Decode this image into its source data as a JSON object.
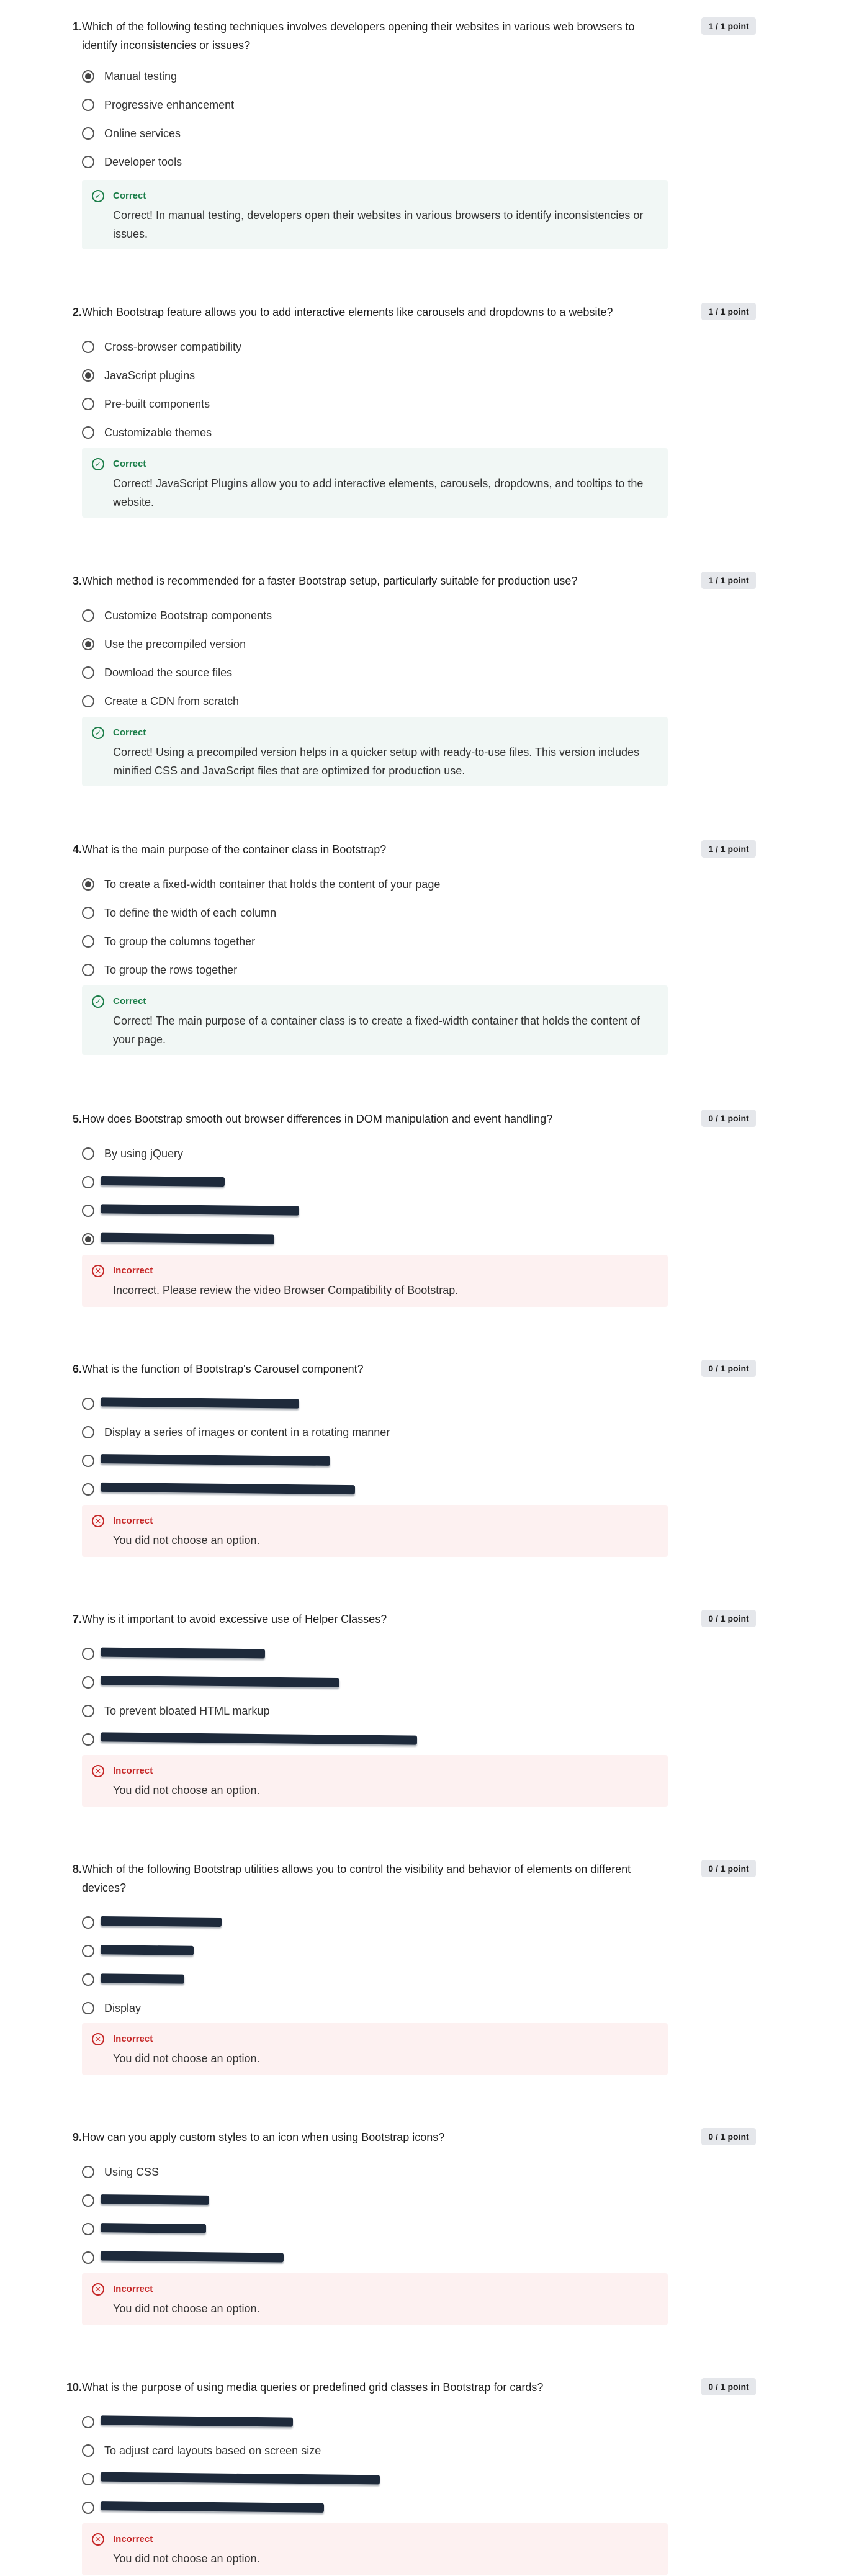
{
  "questions": [
    {
      "number": "1.",
      "text": "Which of the following testing techniques involves developers opening their websites in various web browsers to identify inconsistencies or issues?",
      "score": "1 / 1 point",
      "options": [
        {
          "label": "Manual testing",
          "selected": true
        },
        {
          "label": "Progressive enhancement",
          "selected": false
        },
        {
          "label": "Online services",
          "selected": false
        },
        {
          "label": "Developer tools",
          "selected": false
        }
      ],
      "feedback": {
        "status": "Correct",
        "text": "Correct! In manual testing, developers open their websites in various browsers to identify inconsistencies or issues."
      }
    },
    {
      "number": "2.",
      "text": "Which Bootstrap feature allows you to add interactive elements like carousels and dropdowns to a website?",
      "score": "1 / 1 point",
      "options": [
        {
          "label": "Cross-browser compatibility",
          "selected": false
        },
        {
          "label": "JavaScript plugins",
          "selected": true
        },
        {
          "label": "Pre-built components",
          "selected": false
        },
        {
          "label": "Customizable themes",
          "selected": false
        }
      ],
      "feedback": {
        "status": "Correct",
        "text": "Correct! JavaScript Plugins allow you to add interactive elements, carousels, dropdowns, and tooltips to the website."
      }
    },
    {
      "number": "3.",
      "text": "Which method is recommended for a faster Bootstrap setup, particularly suitable for production use?",
      "score": "1 / 1 point",
      "options": [
        {
          "label": "Customize Bootstrap components",
          "selected": false
        },
        {
          "label": "Use the precompiled version",
          "selected": true
        },
        {
          "label": "Download the source files",
          "selected": false
        },
        {
          "label": "Create a CDN from scratch",
          "selected": false
        }
      ],
      "feedback": {
        "status": "Correct",
        "text": "Correct! Using a precompiled version helps in a quicker setup with ready-to-use files. This version includes minified CSS and JavaScript files that are optimized for production use."
      }
    },
    {
      "number": "4.",
      "text": "What is the main purpose of the container class in Bootstrap?",
      "score": "1 / 1 point",
      "options": [
        {
          "label": "To create a fixed-width container that holds the content of your page",
          "selected": true
        },
        {
          "label": "To define the width of each column",
          "selected": false
        },
        {
          "label": "To group the columns together",
          "selected": false
        },
        {
          "label": "To group the rows together",
          "selected": false
        }
      ],
      "feedback": {
        "status": "Correct",
        "text": "Correct! The main purpose of a container class is to create a fixed-width container that holds the content of your page."
      }
    },
    {
      "number": "5.",
      "text": "How does Bootstrap smooth out browser differences in DOM manipulation and event handling?",
      "score": "0 / 1 point",
      "options": [
        {
          "label": "By using jQuery",
          "selected": false
        },
        {
          "label": "",
          "selected": false
        },
        {
          "label": "",
          "selected": false
        },
        {
          "label": "",
          "selected": true
        }
      ],
      "feedback": {
        "status": "Incorrect",
        "text": "Incorrect. Please review the video Browser Compatibility of Bootstrap."
      }
    },
    {
      "number": "6.",
      "text": "What is the function of Bootstrap's Carousel component?",
      "score": "0 / 1 point",
      "options": [
        {
          "label": "",
          "selected": false
        },
        {
          "label": "Display a series of images or content in a rotating manner",
          "selected": false
        },
        {
          "label": "",
          "selected": false
        },
        {
          "label": "",
          "selected": false
        }
      ],
      "feedback": {
        "status": "Incorrect",
        "text": "You did not choose an option."
      }
    },
    {
      "number": "7.",
      "text": "Why is it important to avoid excessive use of Helper Classes?",
      "score": "0 / 1 point",
      "options": [
        {
          "label": "",
          "selected": false
        },
        {
          "label": "",
          "selected": false
        },
        {
          "label": "To prevent bloated HTML markup",
          "selected": false
        },
        {
          "label": "",
          "selected": false
        }
      ],
      "feedback": {
        "status": "Incorrect",
        "text": "You did not choose an option."
      }
    },
    {
      "number": "8.",
      "text": "Which of the following Bootstrap utilities allows you to control the visibility and behavior of elements on different devices?",
      "score": "0 / 1 point",
      "options": [
        {
          "label": "",
          "selected": false
        },
        {
          "label": "",
          "selected": false
        },
        {
          "label": "",
          "selected": false
        },
        {
          "label": "Display",
          "selected": false
        }
      ],
      "feedback": {
        "status": "Incorrect",
        "text": "You did not choose an option."
      }
    },
    {
      "number": "9.",
      "text": "How can you apply custom styles to an icon when using Bootstrap icons?",
      "score": "0 / 1 point",
      "options": [
        {
          "label": "Using CSS",
          "selected": false
        },
        {
          "label": "",
          "selected": false
        },
        {
          "label": "",
          "selected": false
        },
        {
          "label": "",
          "selected": false
        }
      ],
      "feedback": {
        "status": "Incorrect",
        "text": "You did not choose an option."
      }
    },
    {
      "number": "10.",
      "text": "What is the purpose of using media queries or predefined grid classes in Bootstrap for cards?",
      "score": "0 / 1 point",
      "options": [
        {
          "label": "",
          "selected": false
        },
        {
          "label": "To adjust card layouts based on screen size",
          "selected": false
        },
        {
          "label": "",
          "selected": false
        },
        {
          "label": "",
          "selected": false
        }
      ],
      "feedback": {
        "status": "Incorrect",
        "text": "You did not choose an option."
      }
    }
  ]
}
